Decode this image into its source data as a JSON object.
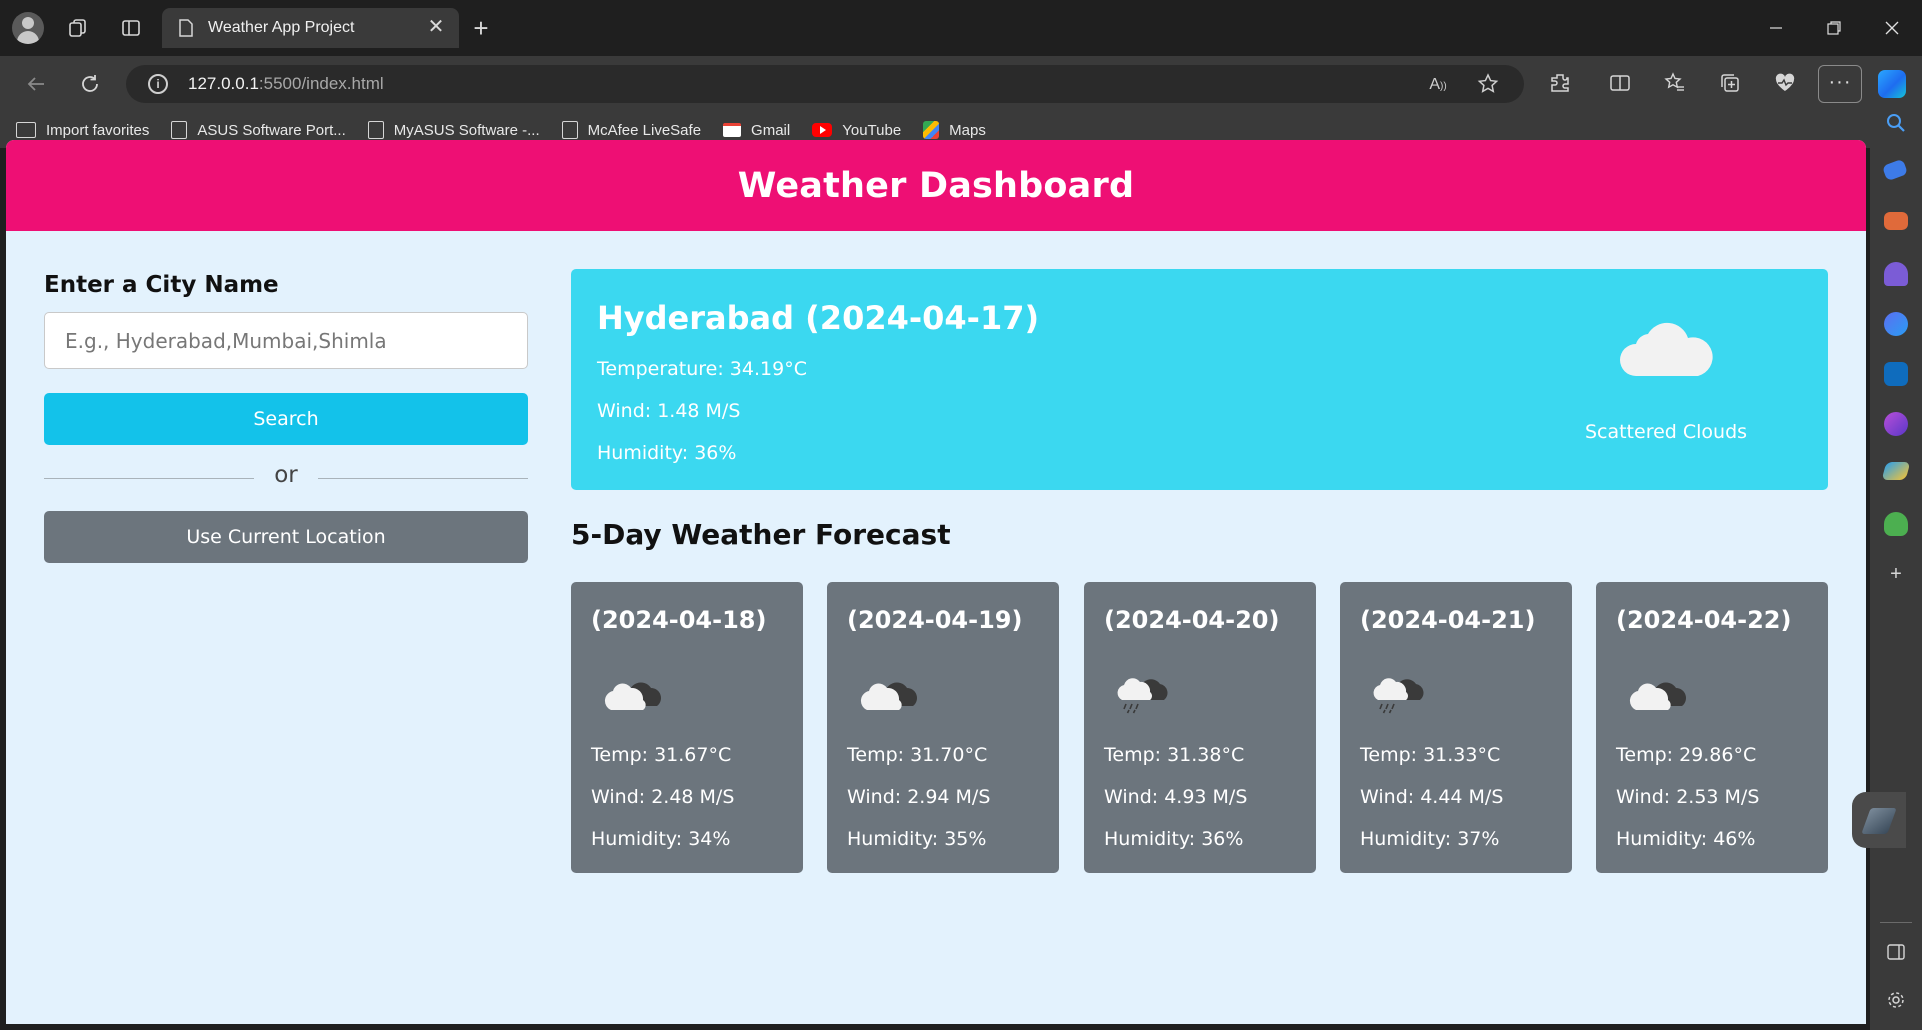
{
  "browser": {
    "tab_title": "Weather App Project",
    "tab_close": "✕",
    "new_tab": "+",
    "url_host": "127.0.0.1",
    "url_path": ":5500/index.html",
    "more": "···"
  },
  "favorites": [
    {
      "label": "Import favorites",
      "icon": "import-folder-icon"
    },
    {
      "label": "ASUS Software Port...",
      "icon": "page-icon"
    },
    {
      "label": "MyASUS Software -...",
      "icon": "page-icon"
    },
    {
      "label": "McAfee LiveSafe",
      "icon": "page-icon"
    },
    {
      "label": "Gmail",
      "icon": "gmail-icon"
    },
    {
      "label": "YouTube",
      "icon": "youtube-icon"
    },
    {
      "label": "Maps",
      "icon": "maps-icon"
    }
  ],
  "colors": {
    "header": "#ee0f74",
    "search_button": "#13c2ea",
    "location_button": "#6c757d",
    "current_card": "#3bd8f0",
    "forecast_card": "#6c757d",
    "page_background": "#e3f2fd"
  },
  "page": {
    "title": "Weather Dashboard",
    "city_label": "Enter a City Name",
    "city_placeholder": "E.g., Hyderabad,Mumbai,Shimla",
    "search_label": "Search",
    "or_label": "or",
    "location_label": "Use Current Location"
  },
  "current": {
    "title": "Hyderabad (2024-04-17)",
    "temperature": "Temperature: 34.19°C",
    "wind": "Wind: 1.48 M/S",
    "humidity": "Humidity: 36%",
    "icon": "cloud-icon",
    "description": "Scattered Clouds"
  },
  "forecast": {
    "title": "5-Day Weather Forecast",
    "days": [
      {
        "date": "(2024-04-18)",
        "icon": "broken-clouds-icon",
        "temp": "Temp: 31.67°C",
        "wind": "Wind: 2.48 M/S",
        "humidity": "Humidity: 34%"
      },
      {
        "date": "(2024-04-19)",
        "icon": "broken-clouds-icon",
        "temp": "Temp: 31.70°C",
        "wind": "Wind: 2.94 M/S",
        "humidity": "Humidity: 35%"
      },
      {
        "date": "(2024-04-20)",
        "icon": "rain-cloud-icon",
        "temp": "Temp: 31.38°C",
        "wind": "Wind: 4.93 M/S",
        "humidity": "Humidity: 36%"
      },
      {
        "date": "(2024-04-21)",
        "icon": "rain-cloud-icon",
        "temp": "Temp: 31.33°C",
        "wind": "Wind: 4.44 M/S",
        "humidity": "Humidity: 37%"
      },
      {
        "date": "(2024-04-22)",
        "icon": "broken-clouds-icon",
        "temp": "Temp: 29.86°C",
        "wind": "Wind: 2.53 M/S",
        "humidity": "Humidity: 46%"
      }
    ]
  }
}
